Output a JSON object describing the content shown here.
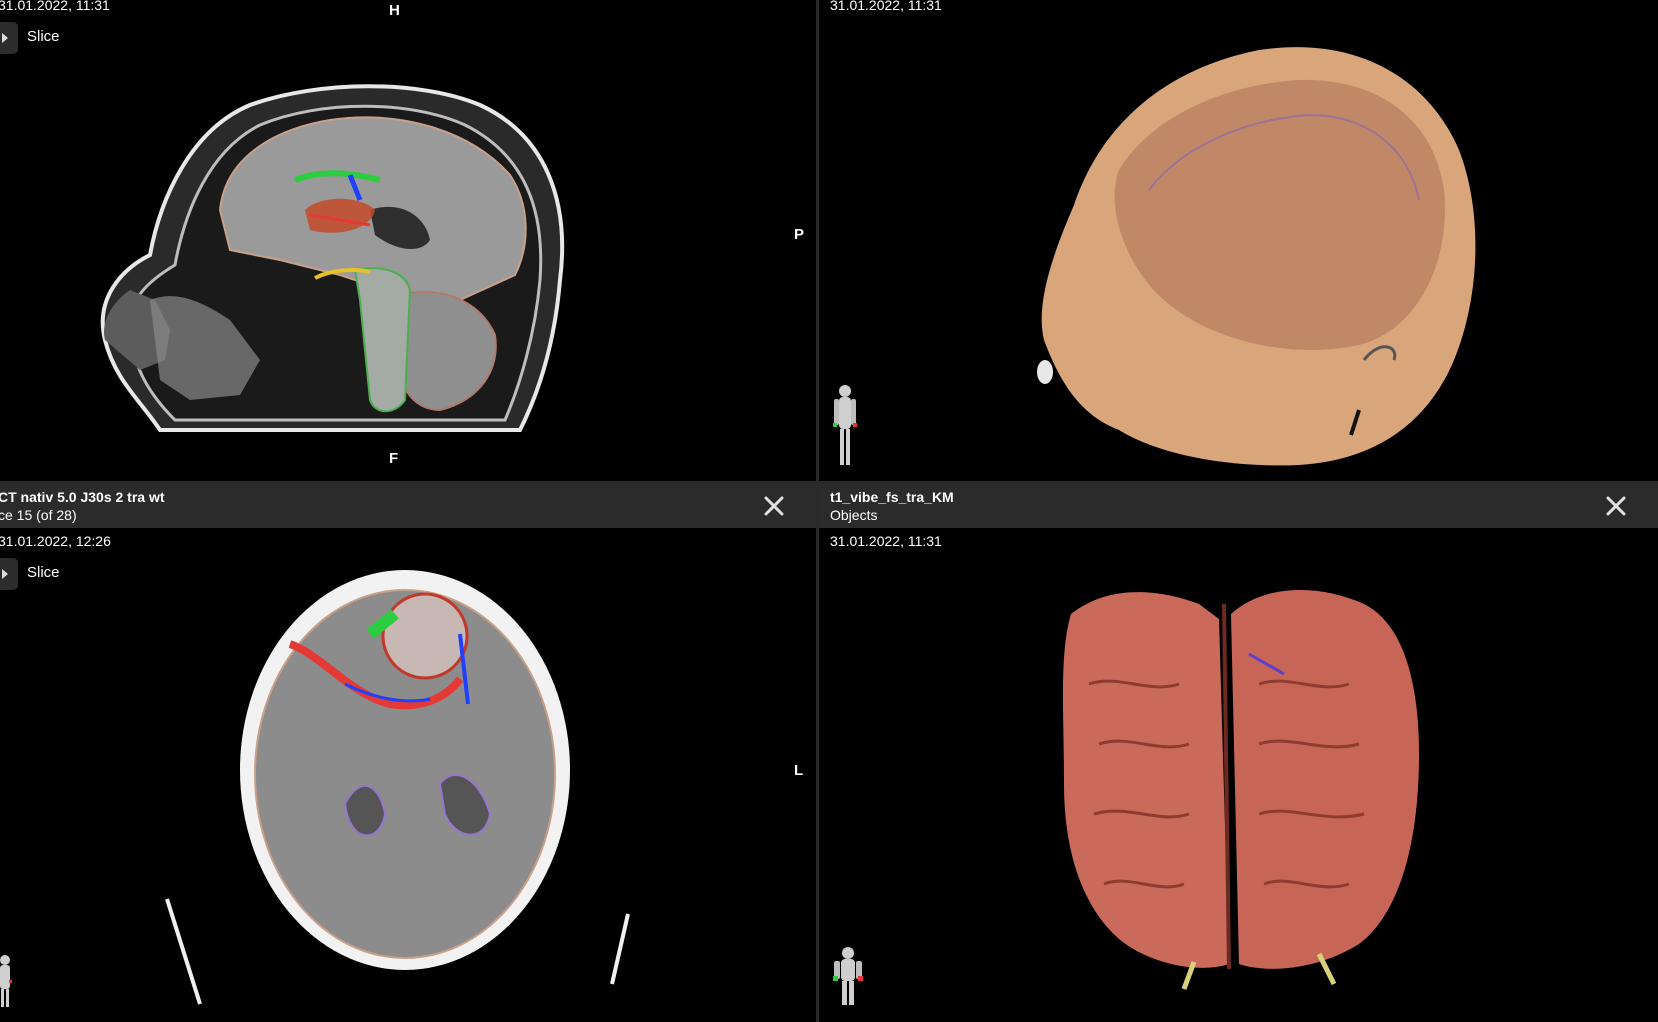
{
  "viewports": {
    "top_left": {
      "date": "31.01.2022, 11:31",
      "slice_label": "Slice",
      "orientation": {
        "top": "H",
        "right": "P",
        "bottom": "F"
      }
    },
    "top_right": {
      "date": "31.01.2022, 11:31"
    },
    "bottom_left": {
      "series_title": "CT nativ 5.0 J30s 2 tra wt",
      "series_sub": "ce 15 (of 28)",
      "date": "31.01.2022, 12:26",
      "slice_label": "Slice",
      "orientation": {
        "right": "L"
      }
    },
    "bottom_right": {
      "series_title": "t1_vibe_fs_tra_KM",
      "series_sub": "Objects",
      "date": "31.01.2022, 11:31"
    }
  },
  "icons": {
    "close": "close-icon",
    "slice_toggle": "play-arrow-icon",
    "orientation_figure": "body-orientation-icon"
  },
  "colors": {
    "background": "#000000",
    "header": "#2b2b2b",
    "skin": "#d9a57a",
    "brain": "#c96a5a"
  }
}
